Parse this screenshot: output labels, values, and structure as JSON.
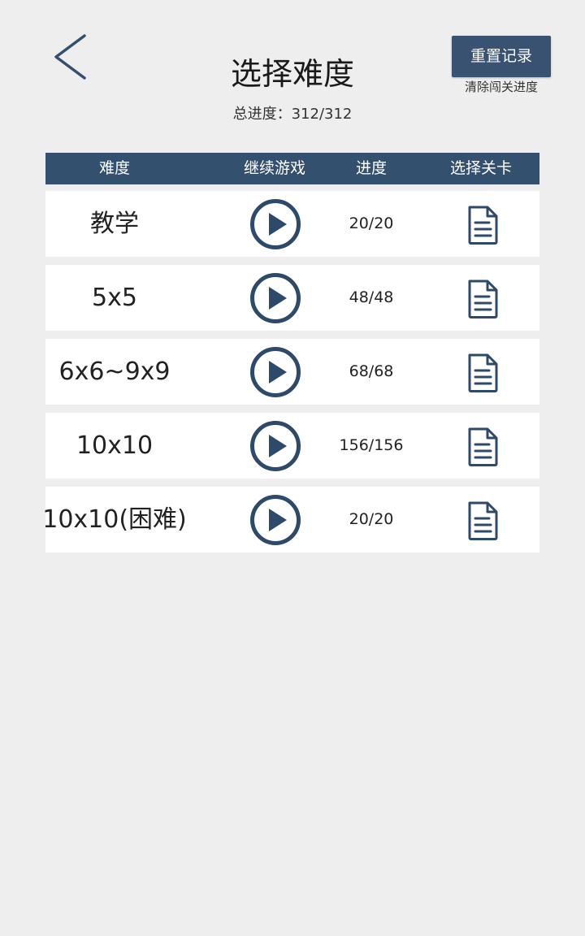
{
  "header": {
    "title": "选择难度",
    "total_progress": "总进度：312/312",
    "reset_button": "重置记录",
    "reset_hint": "清除闯关进度"
  },
  "table": {
    "columns": [
      "难度",
      "继续游戏",
      "进度",
      "选择关卡"
    ],
    "rows": [
      {
        "difficulty": "教学",
        "progress": "20/20"
      },
      {
        "difficulty": "5x5",
        "progress": "48/48"
      },
      {
        "difficulty": "6x6~9x9",
        "progress": "68/68"
      },
      {
        "difficulty": "10x10",
        "progress": "156/156"
      },
      {
        "difficulty": "10x10(困难)",
        "progress": "20/20"
      }
    ]
  },
  "icons": {
    "back": "chevron-left-icon",
    "continue": "play-circle-icon",
    "select_level": "document-icon"
  },
  "colors": {
    "background": "#eeeeee",
    "accent": "#34506f",
    "button": "#3a5272",
    "icon": "#2e4a6b",
    "row": "#ffffff"
  }
}
